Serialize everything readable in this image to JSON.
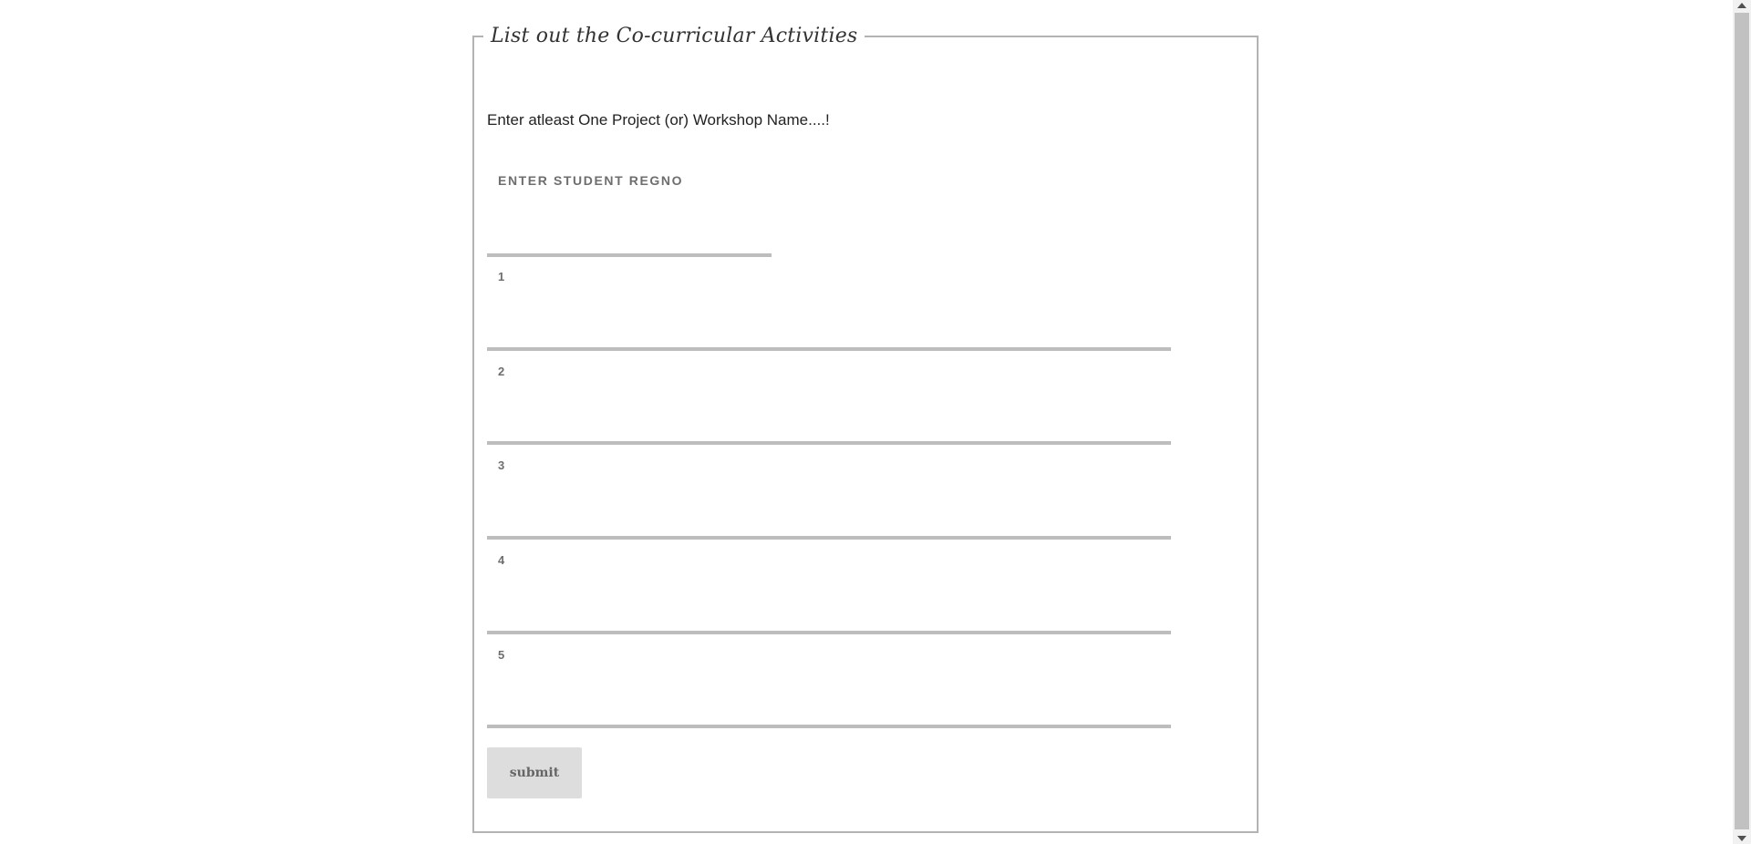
{
  "form": {
    "legend": "List out the Co-curricular Activities",
    "instruction": "Enter atleast One Project (or) Workshop Name....!",
    "regno": {
      "label": "ENTER STUDENT REGNO",
      "value": ""
    },
    "activities": [
      {
        "label": "1",
        "value": ""
      },
      {
        "label": "2",
        "value": ""
      },
      {
        "label": "3",
        "value": ""
      },
      {
        "label": "4",
        "value": ""
      },
      {
        "label": "5",
        "value": ""
      }
    ],
    "submit_label": "submit"
  }
}
